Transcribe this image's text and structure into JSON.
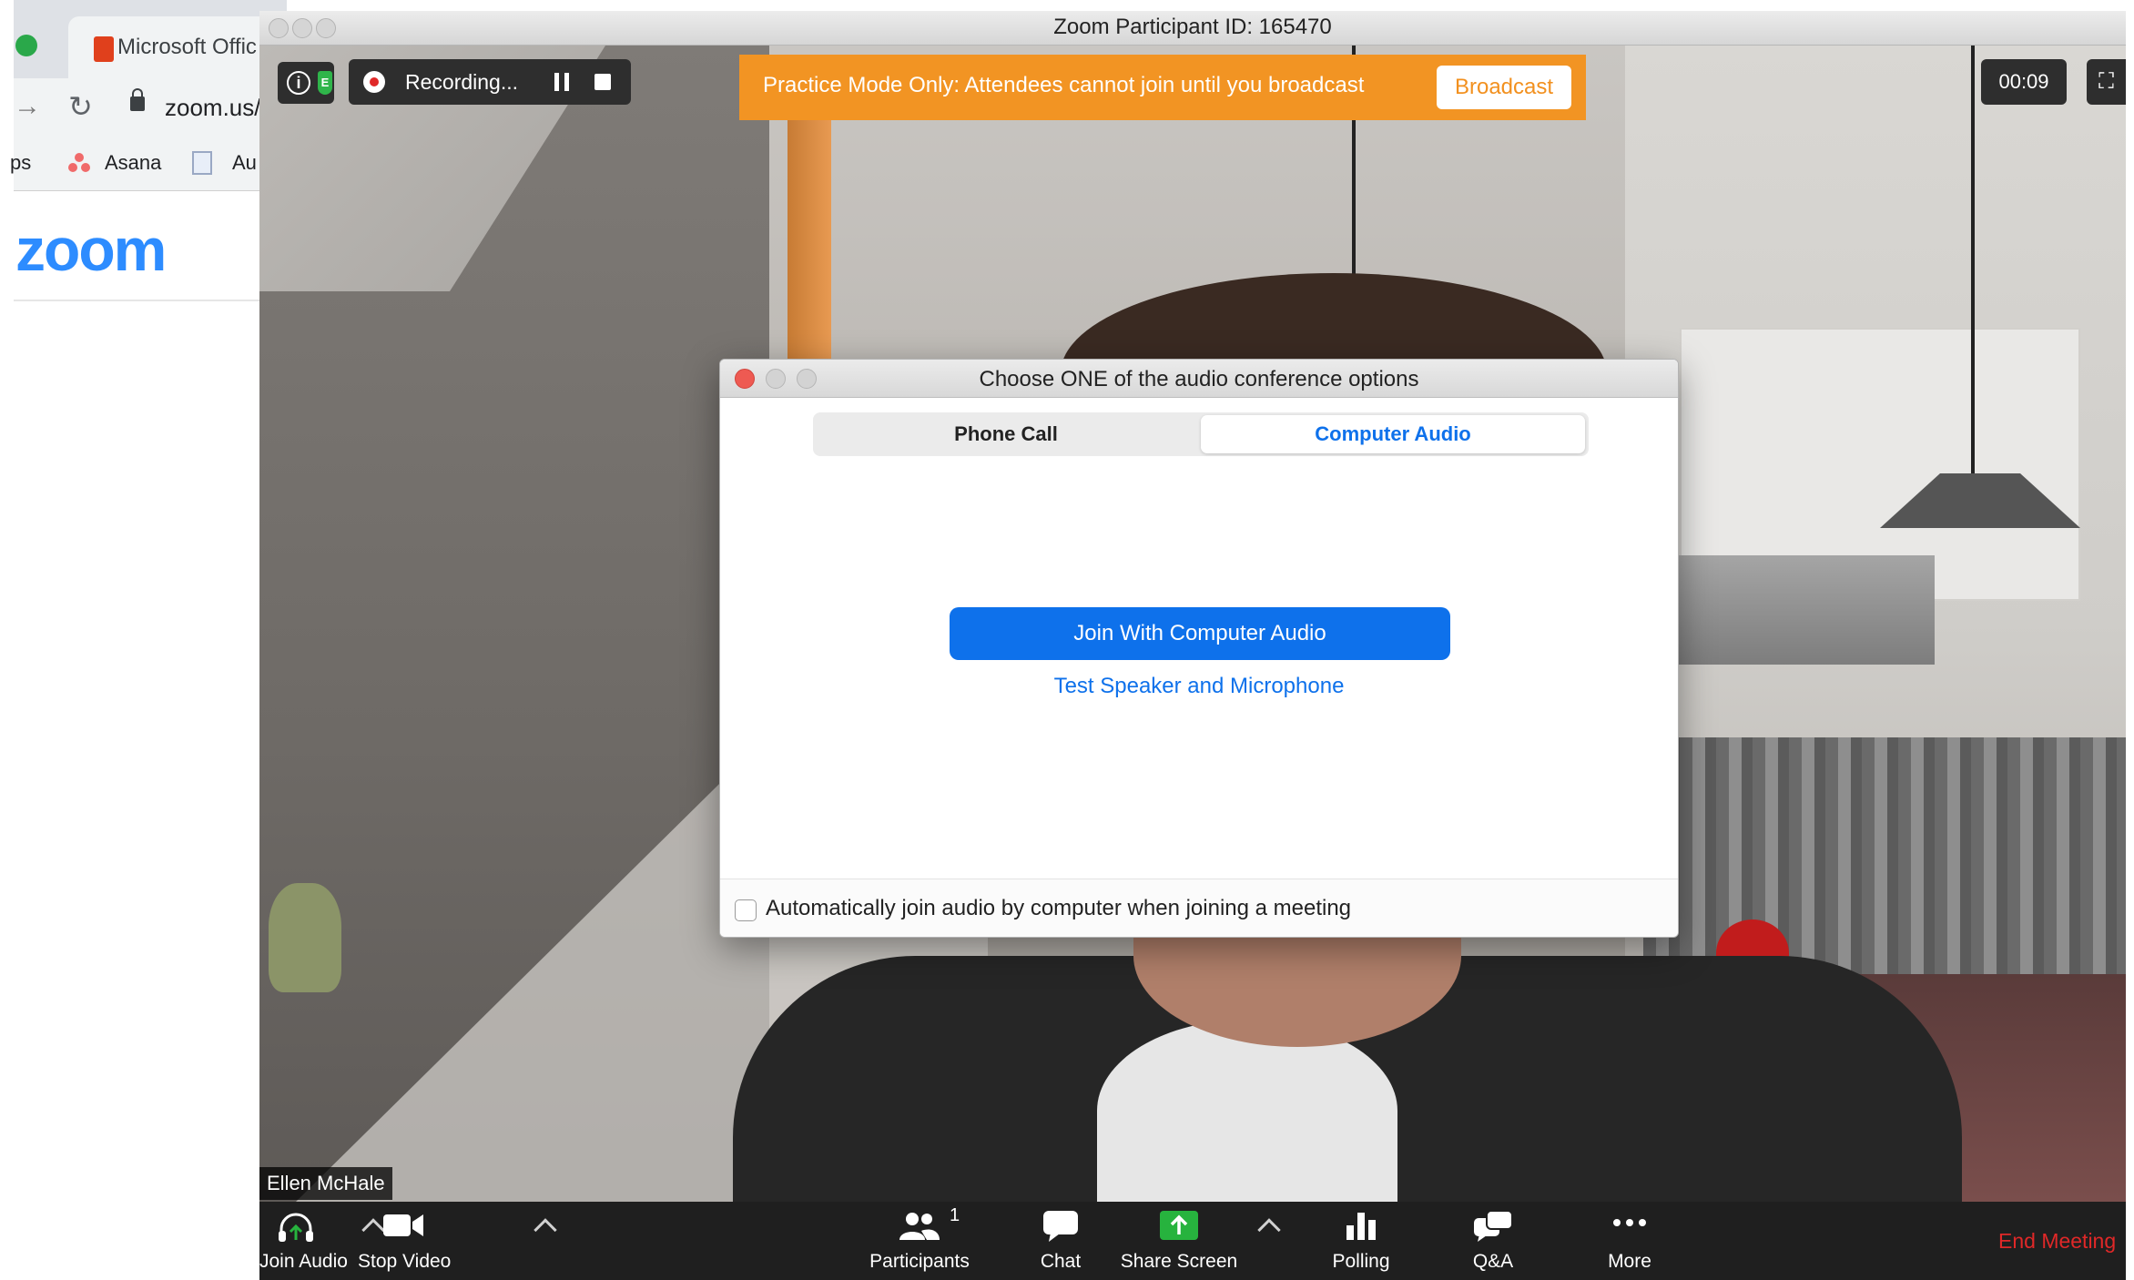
{
  "browser": {
    "tab_title": "Microsoft Offic",
    "url": "zoom.us/",
    "bookmarks": [
      "ps",
      "Asana",
      "Au"
    ],
    "logo_text": "zoom"
  },
  "window": {
    "title": "Zoom Participant ID: 165470"
  },
  "overlay": {
    "recording_label": "Recording...",
    "practice_text": "Practice Mode Only: Attendees cannot join until you broadcast",
    "broadcast_label": "Broadcast",
    "timer": "00:09",
    "shield_letter": "E",
    "info_glyph": "i"
  },
  "video": {
    "participant_name": "Ellen McHale"
  },
  "dialog": {
    "title": "Choose ONE of the audio conference options",
    "tabs": [
      {
        "label": "Phone Call",
        "selected": false
      },
      {
        "label": "Computer Audio",
        "selected": true
      }
    ],
    "join_label": "Join With Computer Audio",
    "test_link": "Test Speaker and Microphone",
    "auto_join_label": "Automatically join audio by computer when joining a meeting",
    "auto_join_checked": false
  },
  "toolbar": {
    "items": [
      {
        "label": "Join Audio",
        "icon": "headphones-icon"
      },
      {
        "label": "Stop Video",
        "icon": "video-camera-icon"
      },
      {
        "label": "Participants",
        "icon": "participants-icon",
        "badge": "1"
      },
      {
        "label": "Chat",
        "icon": "chat-bubble-icon"
      },
      {
        "label": "Share Screen",
        "icon": "share-screen-icon"
      },
      {
        "label": "Polling",
        "icon": "bar-chart-icon"
      },
      {
        "label": "Q&A",
        "icon": "qa-bubbles-icon"
      },
      {
        "label": "More",
        "icon": "more-dots-icon"
      }
    ],
    "end_label": "End Meeting"
  },
  "colors": {
    "zoom_blue": "#0e71eb",
    "practice_orange": "#f29423",
    "end_red": "#e02828",
    "share_green": "#27b33e"
  }
}
